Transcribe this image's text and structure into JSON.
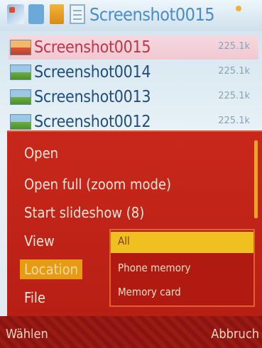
{
  "header": {
    "title": "Screenshot0015"
  },
  "files": [
    {
      "name": "Screenshot0015",
      "size": "225.1k",
      "selected": true
    },
    {
      "name": "Screenshot0014",
      "size": "225.1k",
      "selected": false
    },
    {
      "name": "Screenshot0013",
      "size": "225.1k",
      "selected": false
    },
    {
      "name": "Screenshot0012",
      "size": "225.1k",
      "selected": false
    }
  ],
  "menu": {
    "items": [
      {
        "label": "Open"
      },
      {
        "label": "Open full (zoom mode)"
      },
      {
        "label": "Start slideshow (8)"
      },
      {
        "label": "View"
      },
      {
        "label": "Location"
      },
      {
        "label": "File"
      }
    ],
    "submenu": [
      {
        "label": "All"
      },
      {
        "label": "Phone memory"
      },
      {
        "label": "Memory card"
      }
    ]
  },
  "softkeys": {
    "left": "Wählen",
    "right": "Abbruch"
  }
}
